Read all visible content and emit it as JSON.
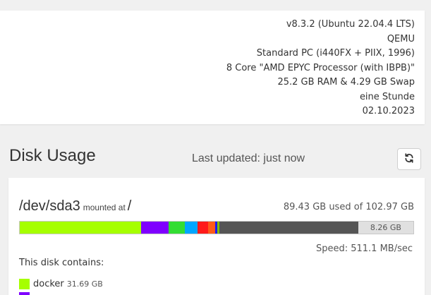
{
  "system_info": {
    "lines": [
      "v8.3.2 (Ubuntu 22.04.4 LTS)",
      "QEMU",
      "Standard PC (i440FX + PIIX, 1996)",
      "8 Core \"AMD EPYC Processor (with IBPB)\"",
      "25.2 GB RAM & 4.29 GB Swap",
      "eine Stunde",
      "02.10.2023"
    ]
  },
  "disk_usage": {
    "title": "Disk Usage",
    "last_updated": "Last updated: just now",
    "refresh_icon": "refresh-icon"
  },
  "disk": {
    "device": "/dev/sda3",
    "mounted_label": "mounted at",
    "mount_point": "/",
    "used_text": "89.43 GB used of 102.97 GB",
    "free_label": "8.26 GB",
    "speed_text": "Speed: 511.1 MB/sec",
    "contains_label": "This disk contains:",
    "segments": [
      {
        "color": "#a6ff00",
        "fraction": 0.308
      },
      {
        "color": "#7f00ff",
        "fraction": 0.0695
      },
      {
        "color": "#33dd33",
        "fraction": 0.041
      },
      {
        "color": "#00a6ff",
        "fraction": 0.0335
      },
      {
        "color": "#ff1a1a",
        "fraction": 0.027
      },
      {
        "color": "#ff5a1a",
        "fraction": 0.018
      },
      {
        "color": "#1a1aff",
        "fraction": 0.0055
      },
      {
        "color": "#7fbf00",
        "fraction": 0.0045
      },
      {
        "color": "#555555",
        "fraction": 0.353
      }
    ],
    "contents": [
      {
        "name": "docker",
        "size": "31.69 GB",
        "color": "#a6ff00"
      }
    ]
  }
}
